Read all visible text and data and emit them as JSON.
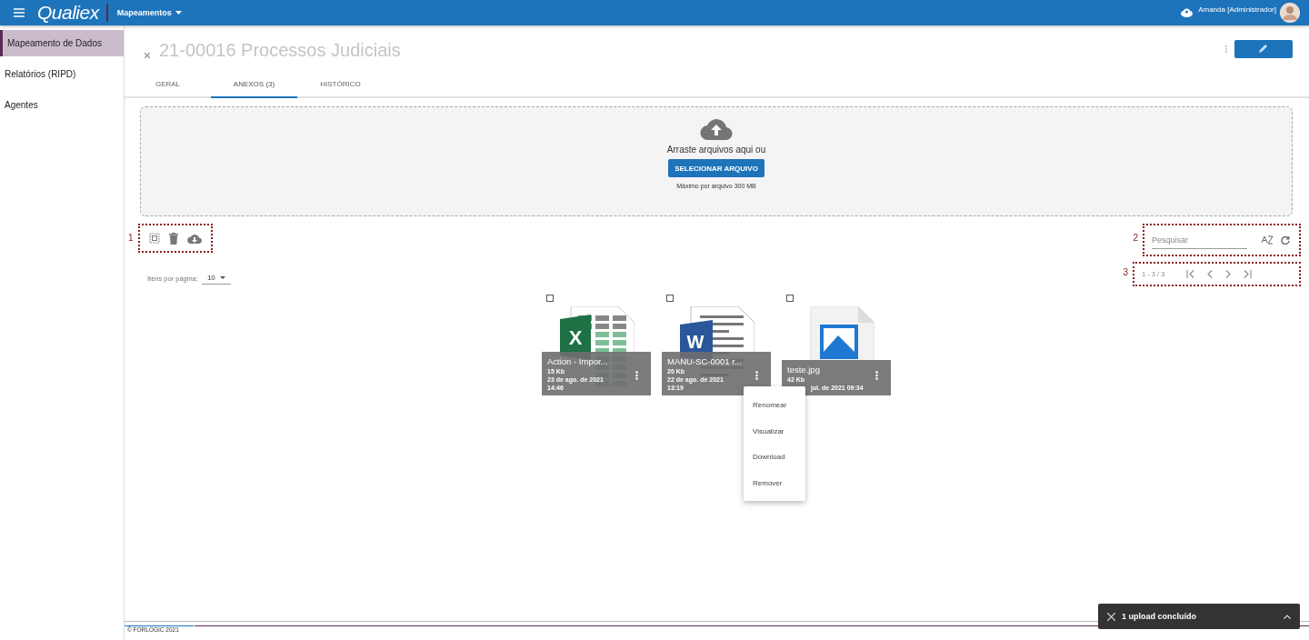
{
  "topbar": {
    "logo": "Qualiex",
    "module": "Mapeamentos",
    "user": "Amanda [Administrador]"
  },
  "sidebar": {
    "items": [
      {
        "label": "Mapeamento de Dados",
        "selected": true
      },
      {
        "label": "Relatórios (RIPD)",
        "selected": false
      },
      {
        "label": "Agentes",
        "selected": false
      }
    ]
  },
  "record": {
    "title": "21-00016 Processos Judiciais"
  },
  "tabs": [
    {
      "label": "GERAL",
      "selected": false
    },
    {
      "label": "ANEXOS (3)",
      "selected": true
    },
    {
      "label": "HISTÓRICO",
      "selected": false
    }
  ],
  "upload": {
    "prompt": "Arraste arquivos aqui ou",
    "button": "SELECIONAR ARQUIVO",
    "limit": "Máximo por arquivo 300 MB"
  },
  "toolbar": {
    "marker": "1"
  },
  "paging": {
    "label": "Itens por página:",
    "value": "10"
  },
  "search": {
    "marker": "2",
    "placeholder": "Pesquisar"
  },
  "pagination": {
    "marker": "3",
    "range": "1 - 3 / 3"
  },
  "files": [
    {
      "kind": "excel",
      "badge": "X",
      "name": "Action - Impor...",
      "size": "15 Kb",
      "date": "23 de ago. de 2021",
      "time": "14:46",
      "checked": false
    },
    {
      "kind": "word",
      "badge": "W",
      "name": "MANU-SC-0001 r...",
      "size": "20 Kb",
      "date": "22 de ago. de 2021",
      "time": "13:19",
      "checked": false
    },
    {
      "kind": "image",
      "name": "teste.jpg",
      "size": "42 Kb",
      "date": "jul. de 2021 09:34",
      "checked": false
    }
  ],
  "context_menu": {
    "items": [
      "Renomear",
      "Visualizar",
      "Download",
      "Remover"
    ]
  },
  "footer": {
    "text": "© FORLOGIC 2021"
  },
  "toast": {
    "text": "1 upload concluído"
  }
}
